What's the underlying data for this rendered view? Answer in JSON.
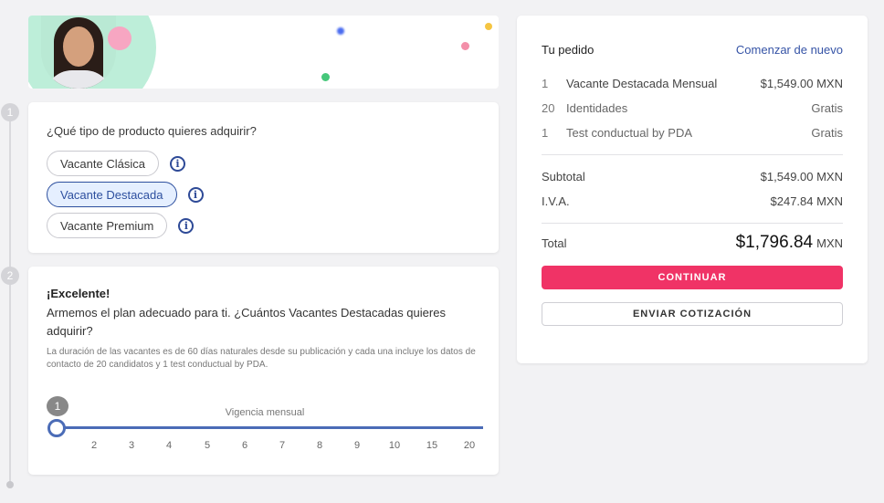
{
  "steps": {
    "step1_number": "1",
    "step2_number": "2"
  },
  "product_question": "¿Qué tipo de producto quieres adquirir?",
  "product_options": [
    {
      "label": "Vacante Clásica",
      "selected": false
    },
    {
      "label": "Vacante Destacada",
      "selected": true
    },
    {
      "label": "Vacante Premium",
      "selected": false
    }
  ],
  "info_icon_glyph": "i",
  "quantity_section": {
    "headline": "¡Excelente!",
    "subtitle": "Armemos el plan adecuado para ti. ¿Cuántos Vacantes Destacadas quieres adquirir?",
    "description": "La duración de las vacantes es de 60 días naturales desde su publicación y cada una incluye los datos de contacto de 20 candidatos y 1 test conductual by PDA.",
    "slider_value": "1",
    "slider_caption": "Vigencia mensual",
    "ticks": [
      "2",
      "3",
      "4",
      "5",
      "6",
      "7",
      "8",
      "9",
      "10",
      "15",
      "20"
    ]
  },
  "order": {
    "title": "Tu pedido",
    "restart_link": "Comenzar de nuevo",
    "items": [
      {
        "qty": "1",
        "name": "Vacante Destacada Mensual",
        "price": "$1,549.00 MXN"
      },
      {
        "qty": "20",
        "name": "Identidades",
        "price": "Gratis"
      },
      {
        "qty": "1",
        "name": "Test conductual by PDA",
        "price": "Gratis"
      }
    ],
    "subtotal_label": "Subtotal",
    "subtotal_value": "$1,549.00 MXN",
    "tax_label": "I.V.A.",
    "tax_value": "$247.84 MXN",
    "total_label": "Total",
    "total_value": "$1,796.84",
    "total_currency": "MXN",
    "continue_button": "CONTINUAR",
    "quote_button": "ENVIAR COTIZACIÓN"
  },
  "colors": {
    "accent_blue": "#2d4f9e",
    "primary_pink": "#f03366",
    "link_blue": "#3553a6"
  }
}
